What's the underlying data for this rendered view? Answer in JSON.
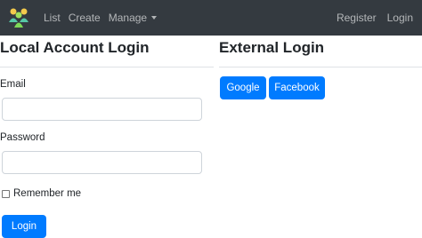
{
  "navbar": {
    "brand_icon": "people-logo-icon",
    "links": [
      "List",
      "Create",
      "Manage"
    ],
    "right_links": [
      "Register",
      "Login"
    ]
  },
  "local_login": {
    "title": "Local Account Login",
    "email_label": "Email",
    "password_label": "Password",
    "remember_label": "Remember me",
    "submit_label": "Login"
  },
  "external_login": {
    "title": "External Login",
    "providers": [
      "Google",
      "Facebook"
    ]
  },
  "colors": {
    "navbar_bg": "#343a40",
    "primary": "#007bff",
    "divider": "#dee2e6"
  }
}
